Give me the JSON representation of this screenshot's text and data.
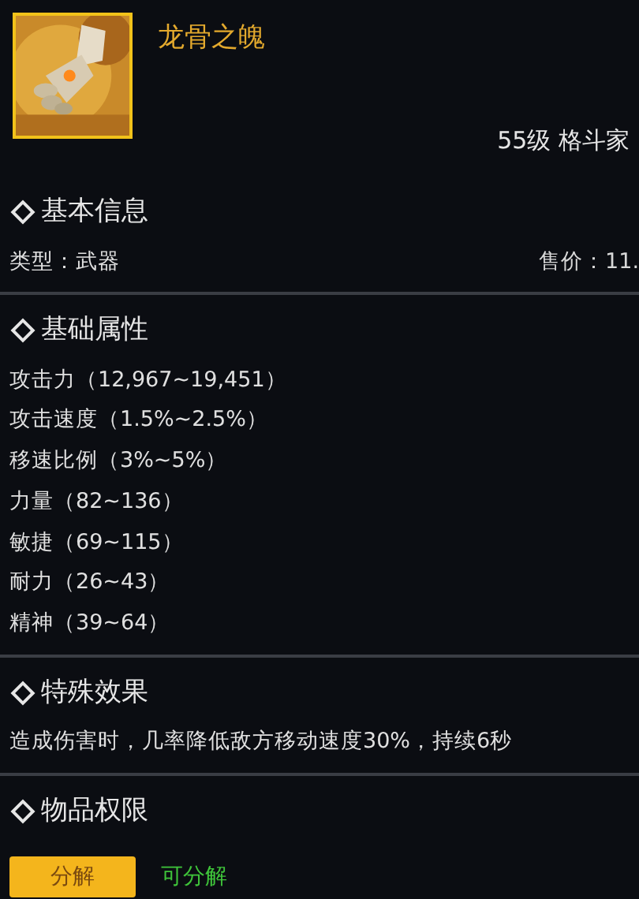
{
  "item": {
    "kind": "picture",
    "name": "龙骨之魄",
    "requirement": "55级 格斗家"
  },
  "sections": [
    {
      "title": "基本信息",
      "kind": "info",
      "left": "类型：武器",
      "right": "售价：11."
    },
    {
      "title": "基础属性",
      "kind": "list",
      "lines": [
        "攻击力（12,967~19,451）",
        "攻击速度（1.5%~2.5%）",
        "移速比例（3%~5%）",
        "力量（82~136）",
        "敏捷（69~115）",
        "耐力（26~43）",
        "精神（39~64）"
      ]
    },
    {
      "title": "特殊效果",
      "kind": "list",
      "lines": [
        "造成伤害时，几率降低敌方移动速度30%，持续6秒"
      ]
    },
    {
      "title": "物品权限",
      "kind": "action",
      "button": "分解",
      "status": "可分解"
    }
  ]
}
